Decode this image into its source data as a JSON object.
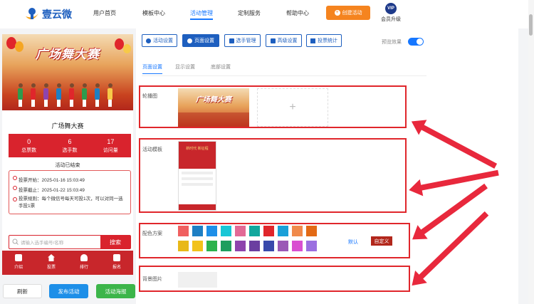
{
  "brand": {
    "name": "壹云微"
  },
  "nav": {
    "items": [
      "用户首页",
      "模板中心",
      "活动管理",
      "定制服务",
      "帮助中心"
    ],
    "active_index": 2,
    "create_button": "创建活动",
    "vip_badge": "VIP",
    "vip_label": "会员升级"
  },
  "preview": {
    "banner_title": "广场舞大赛",
    "event_title": "广场舞大赛",
    "stats": [
      {
        "value": "0",
        "label": "总票数"
      },
      {
        "value": "6",
        "label": "选手数"
      },
      {
        "value": "17",
        "label": "访问量"
      }
    ],
    "status": "活动已结束",
    "info": [
      "投票开始：2025-01-16 15:03:49",
      "投票截止：2025-01-22 15:03:49",
      "投票规则：每个微信号每天可投1次，可以对同一选手投1票"
    ],
    "search_placeholder": "请输入选手编号/名称",
    "search_button": "搜索",
    "tabbar": [
      "介绍",
      "投票",
      "排行",
      "报名"
    ]
  },
  "bottom_buttons": {
    "refresh": "刷新",
    "publish": "发布活动",
    "poster": "活动海报"
  },
  "settings": {
    "tabs": [
      "活动设置",
      "页面设置",
      "选手管理",
      "高级设置",
      "投票统计"
    ],
    "active_tab": 1,
    "preview_label": "预览效果",
    "preview_enabled": true,
    "subtabs": [
      "页面设置",
      "显示设置",
      "底部设置"
    ],
    "active_subtab": 0,
    "carousel_label": "轮播图",
    "carousel_image_title": "广场舞大赛",
    "carousel_add": "+",
    "template_label": "活动模板",
    "template_title": "新时代 新征程",
    "color_label": "配色方案",
    "colors_row1": [
      "#f06060",
      "#1e7fc4",
      "#1e8fe8",
      "#19c6d6",
      "#e26a96",
      "#12a79d",
      "#e0262b",
      "#1aa0d8",
      "#f08a4b",
      "#e36a15"
    ],
    "colors_row2": [
      "#e8b818",
      "#f2c21a",
      "#2bb24c",
      "#1f9e5e",
      "#8e44ad",
      "#6b3fa0",
      "#3949ab",
      "#9b59b6",
      "#d94fd1",
      "#9b6fe0"
    ],
    "color_default": "默认",
    "color_custom": "自定义",
    "bgimage_label": "背景图片"
  }
}
